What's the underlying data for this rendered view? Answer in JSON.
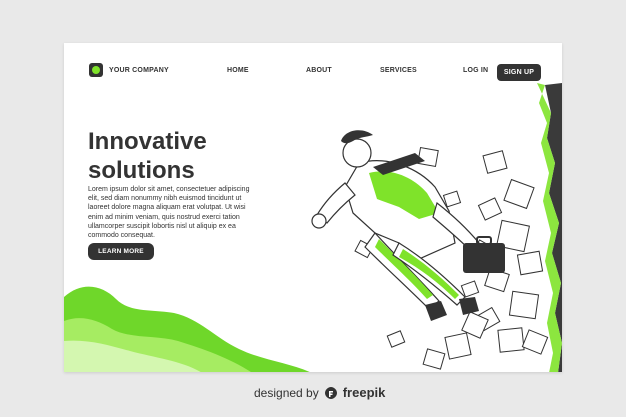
{
  "header": {
    "logo_text": "YOUR COMPANY",
    "nav": [
      "HOME",
      "ABOUT",
      "SERVICES"
    ],
    "login_label": "LOG IN",
    "signup_label": "SIGN UP"
  },
  "hero": {
    "title_line1": "Innovative",
    "title_line2": "solutions",
    "body": "Lorem ipsum dolor sit amet, consectetuer adipiscing elit, sed diam nonummy nibh euismod tincidunt ut laoreet dolore magna aliquam erat volutpat. Ut wisi enim ad minim veniam, quis nostrud exerci tation ullamcorper suscipit lobortis nisl ut aliquip ex ea commodo consequat.",
    "cta_label": "LEARN MORE"
  },
  "credit": {
    "label": "designed by",
    "brand": "freepik"
  },
  "colors": {
    "accent": "#7fe32a",
    "dark": "#333333",
    "card": "#ffffff",
    "background": "#e9e9e9"
  },
  "icons": {
    "logo": "logo-icon",
    "freepik": "freepik-logo-icon"
  }
}
